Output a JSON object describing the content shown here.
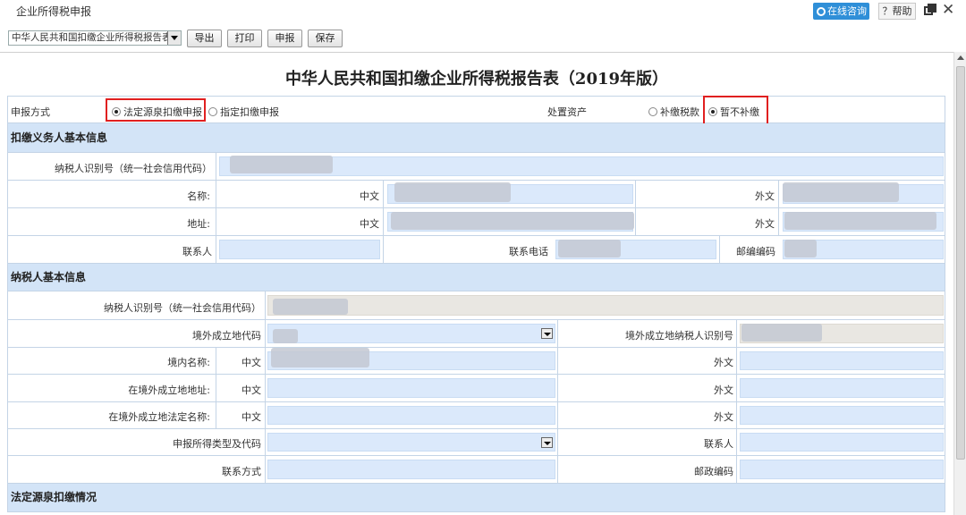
{
  "app": {
    "title": "企业所得税申报",
    "consult_label": "在线咨询",
    "help_label": "？帮助"
  },
  "toolbar": {
    "form_select": "中华人民共和国扣缴企业所得税报告表",
    "export_label": "导出",
    "print_label": "打印",
    "declare_label": "申报",
    "save_label": "保存"
  },
  "form": {
    "title": "中华人民共和国扣缴企业所得税报告表（2019年版）",
    "declare_mode": {
      "label": "申报方式",
      "options": [
        "法定源泉扣缴申报",
        "指定扣缴申报"
      ],
      "selected": "法定源泉扣缴申报"
    },
    "asset_disposal": {
      "label": "处置资产",
      "options": [
        "补缴税款",
        "暂不补缴"
      ],
      "selected": "暂不补缴"
    },
    "withholder_section": "扣缴义务人基本信息",
    "withholder": {
      "id_label": "纳税人识别号（统一社会信用代码）",
      "name_label": "名称:",
      "address_label": "地址:",
      "contact_label": "联系人",
      "phone_label": "联系电话",
      "postcode_label": "邮编编码",
      "cn_label": "中文",
      "foreign_label": "外文"
    },
    "taxpayer_section": "纳税人基本信息",
    "taxpayer": {
      "id_label": "纳税人识别号（统一社会信用代码）",
      "country_code_label": "境外成立地代码",
      "foreign_tin_label": "境外成立地纳税人识别号",
      "domestic_name_label": "境内名称:",
      "foreign_address_label": "在境外成立地地址:",
      "foreign_legal_name_label": "在境外成立地法定名称:",
      "income_type_label": "申报所得类型及代码",
      "contact_label": "联系人",
      "contact_method_label": "联系方式",
      "postcode_label": "邮政编码",
      "cn_label": "中文",
      "foreign_label": "外文"
    },
    "withholding_section": "法定源泉扣缴情况"
  },
  "colors": {
    "section_bg": "#d3e4f7",
    "input_bg": "#dbe9fb",
    "highlight": "#e02020",
    "accent": "#2f8fd8"
  }
}
